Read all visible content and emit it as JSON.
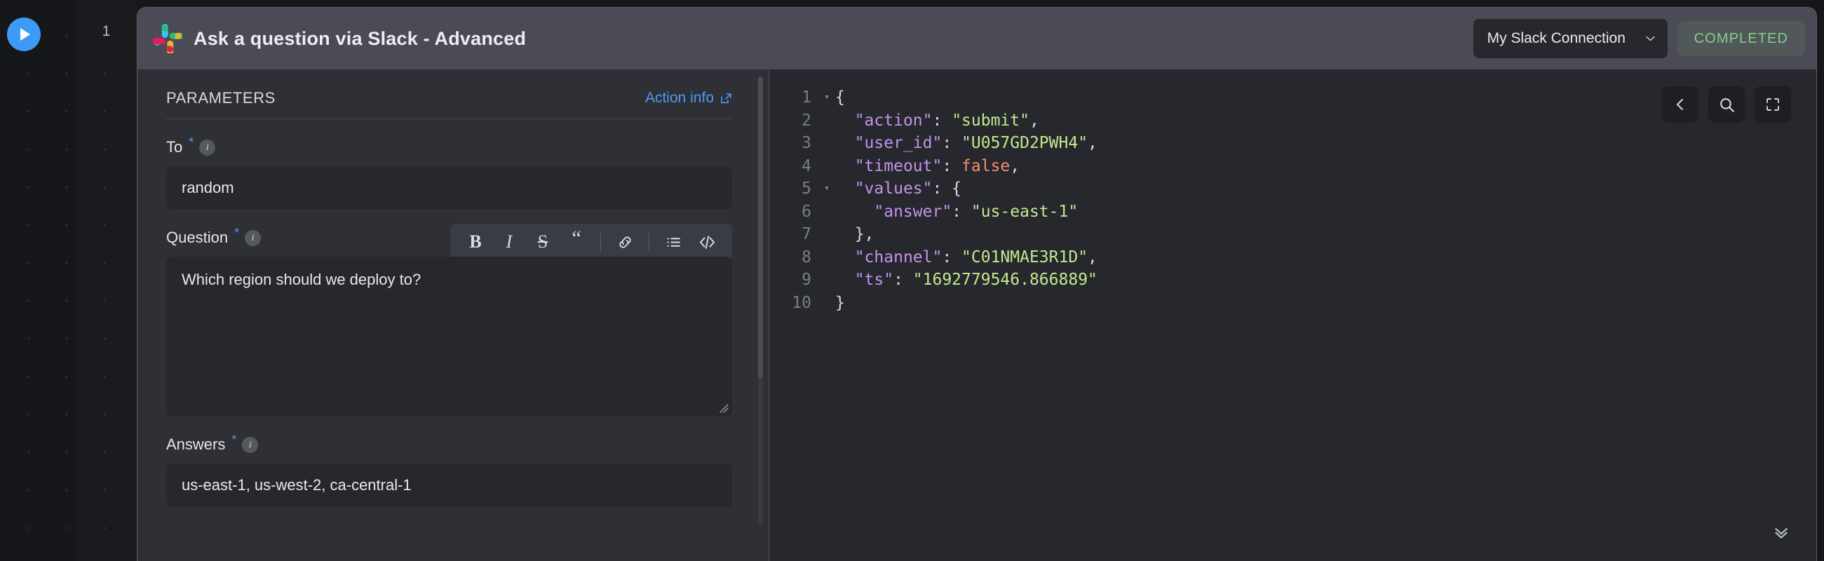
{
  "canvas": {
    "run_button_icon": "play-icon",
    "step_number": "1"
  },
  "card": {
    "app_icon": "slack-logo-icon",
    "title": "Ask a question via Slack - Advanced",
    "connection": {
      "label": "My Slack Connection",
      "chevron_icon": "chevron-down-icon"
    },
    "status": {
      "label": "COMPLETED",
      "color": "#7fd18a"
    }
  },
  "parameters": {
    "heading": "PARAMETERS",
    "action_info": {
      "label": "Action info",
      "icon": "external-link-icon"
    },
    "fields": [
      {
        "label": "To",
        "required_marker": "*",
        "info_icon": "info-icon",
        "value": "random",
        "type": "text"
      },
      {
        "label": "Question",
        "required_marker": "*",
        "info_icon": "info-icon",
        "value": "Which region should we deploy to?",
        "type": "richtext"
      },
      {
        "label": "Answers",
        "required_marker": "*",
        "info_icon": "info-icon",
        "value": "us-east-1, us-west-2, ca-central-1",
        "type": "text"
      }
    ],
    "rich_text_toolbar": [
      {
        "name": "bold-icon",
        "glyph": "B"
      },
      {
        "name": "italic-icon",
        "glyph": "I"
      },
      {
        "name": "strikethrough-icon",
        "glyph": "S"
      },
      {
        "name": "blockquote-icon",
        "glyph": "“"
      },
      {
        "name": "separator",
        "glyph": ""
      },
      {
        "name": "link-icon",
        "glyph": ""
      },
      {
        "name": "separator",
        "glyph": ""
      },
      {
        "name": "bullet-list-icon",
        "glyph": ""
      },
      {
        "name": "code-icon",
        "glyph": "</>"
      }
    ]
  },
  "code_panel": {
    "tools": [
      {
        "name": "back-chevron-icon"
      },
      {
        "name": "search-icon"
      },
      {
        "name": "fullscreen-icon"
      }
    ],
    "collapse_icon": "double-chevron-down-icon",
    "lines": [
      {
        "num": "1",
        "fold": "▾",
        "indent": 0,
        "tokens": [
          {
            "t": "punc",
            "v": "{"
          }
        ]
      },
      {
        "num": "2",
        "fold": "",
        "indent": 1,
        "tokens": [
          {
            "t": "key",
            "v": "\"action\""
          },
          {
            "t": "punc",
            "v": ": "
          },
          {
            "t": "str",
            "v": "\"submit\""
          },
          {
            "t": "punc",
            "v": ","
          }
        ]
      },
      {
        "num": "3",
        "fold": "",
        "indent": 1,
        "tokens": [
          {
            "t": "key",
            "v": "\"user_id\""
          },
          {
            "t": "punc",
            "v": ": "
          },
          {
            "t": "str",
            "v": "\"U057GD2PWH4\""
          },
          {
            "t": "punc",
            "v": ","
          }
        ]
      },
      {
        "num": "4",
        "fold": "",
        "indent": 1,
        "tokens": [
          {
            "t": "key",
            "v": "\"timeout\""
          },
          {
            "t": "punc",
            "v": ": "
          },
          {
            "t": "bool",
            "v": "false"
          },
          {
            "t": "punc",
            "v": ","
          }
        ]
      },
      {
        "num": "5",
        "fold": "▾",
        "indent": 1,
        "tokens": [
          {
            "t": "key",
            "v": "\"values\""
          },
          {
            "t": "punc",
            "v": ": {"
          }
        ]
      },
      {
        "num": "6",
        "fold": "",
        "indent": 2,
        "tokens": [
          {
            "t": "key",
            "v": "\"answer\""
          },
          {
            "t": "punc",
            "v": ": "
          },
          {
            "t": "str",
            "v": "\"us-east-1\""
          }
        ]
      },
      {
        "num": "7",
        "fold": "",
        "indent": 1,
        "tokens": [
          {
            "t": "punc",
            "v": "},"
          }
        ]
      },
      {
        "num": "8",
        "fold": "",
        "indent": 1,
        "tokens": [
          {
            "t": "key",
            "v": "\"channel\""
          },
          {
            "t": "punc",
            "v": ": "
          },
          {
            "t": "str",
            "v": "\"C01NMAE3R1D\""
          },
          {
            "t": "punc",
            "v": ","
          }
        ]
      },
      {
        "num": "9",
        "fold": "",
        "indent": 1,
        "tokens": [
          {
            "t": "key",
            "v": "\"ts\""
          },
          {
            "t": "punc",
            "v": ": "
          },
          {
            "t": "str",
            "v": "\"1692779546.866889\""
          }
        ]
      },
      {
        "num": "10",
        "fold": "",
        "indent": 0,
        "tokens": [
          {
            "t": "punc",
            "v": "}"
          }
        ]
      }
    ]
  }
}
